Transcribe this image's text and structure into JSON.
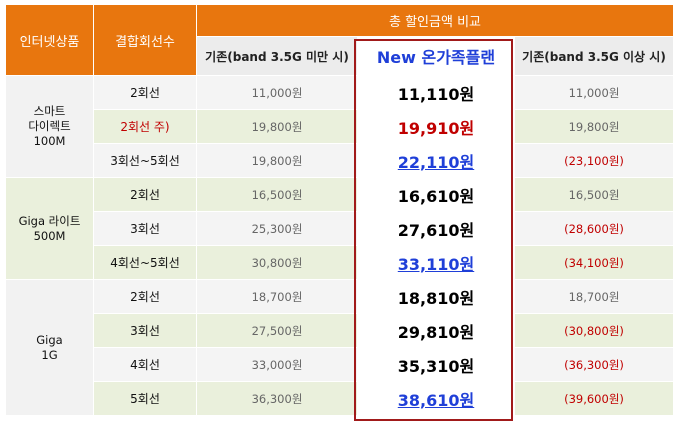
{
  "headers": {
    "col_product": "인터넷상품",
    "col_lines": "결합회선수",
    "col_group": "총 할인금액 비교",
    "col_old_low": "기존(band 3.5G 미만 시)",
    "col_new": "New 온가족플랜",
    "col_old_high": "기존(band 3.5G 이상 시)"
  },
  "groups": [
    {
      "product": [
        "스마트",
        "다이렉트",
        "100M"
      ],
      "rows": [
        {
          "lines": "2회선",
          "old_low": "11,000원",
          "new": "11,110원",
          "old_high": "11,000원",
          "style": "normal"
        },
        {
          "lines": "2회선 주)",
          "old_low": "19,800원",
          "new": "19,910원",
          "old_high": "19,800원",
          "style": "red"
        },
        {
          "lines": "3회선~5회선",
          "old_low": "19,800원",
          "new": "22,110원",
          "old_high": "(23,100원)",
          "style": "blue"
        }
      ]
    },
    {
      "product": [
        "Giga 라이트",
        "500M"
      ],
      "rows": [
        {
          "lines": "2회선",
          "old_low": "16,500원",
          "new": "16,610원",
          "old_high": "16,500원",
          "style": "normal"
        },
        {
          "lines": "3회선",
          "old_low": "25,300원",
          "new": "27,610원",
          "old_high": "(28,600원)",
          "style": "normal"
        },
        {
          "lines": "4회선~5회선",
          "old_low": "30,800원",
          "new": "33,110원",
          "old_high": "(34,100원)",
          "style": "blue"
        }
      ]
    },
    {
      "product": [
        "Giga",
        "1G"
      ],
      "rows": [
        {
          "lines": "2회선",
          "old_low": "18,700원",
          "new": "18,810원",
          "old_high": "18,700원",
          "style": "normal"
        },
        {
          "lines": "3회선",
          "old_low": "27,500원",
          "new": "29,810원",
          "old_high": "(30,800원)",
          "style": "normal"
        },
        {
          "lines": "4회선",
          "old_low": "33,000원",
          "new": "35,310원",
          "old_high": "(36,300원)",
          "style": "normal"
        },
        {
          "lines": "5회선",
          "old_low": "36,300원",
          "new": "38,610원",
          "old_high": "(39,600원)",
          "style": "blue"
        }
      ]
    }
  ],
  "colors": {
    "header": "#e8760e",
    "highlight_frame": "#a11a1a",
    "red": "#c00000",
    "blue": "#1f3fd8"
  }
}
